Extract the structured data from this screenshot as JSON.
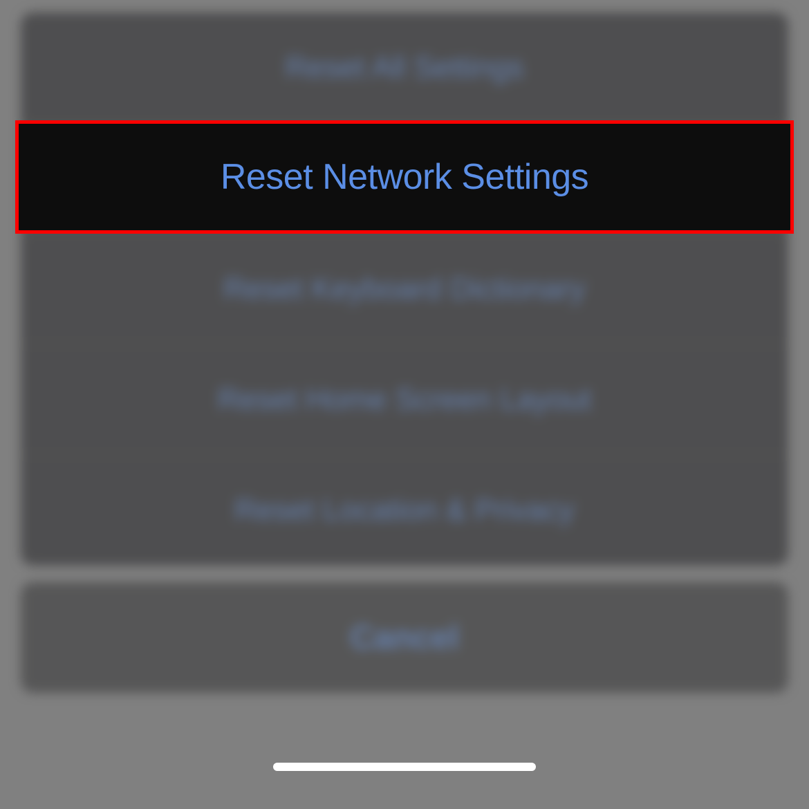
{
  "actionSheet": {
    "items": [
      {
        "label": "Reset All Settings"
      },
      {
        "label": "Reset Network Settings",
        "highlighted": true
      },
      {
        "label": "Reset Keyboard Dictionary"
      },
      {
        "label": "Reset Home Screen Layout"
      },
      {
        "label": "Reset Location & Privacy"
      }
    ],
    "cancel": {
      "label": "Cancel"
    }
  },
  "colors": {
    "actionText": "#5b8ee5",
    "highlightBorder": "#ff0000",
    "sheetBackground": "#1c1c1e"
  }
}
